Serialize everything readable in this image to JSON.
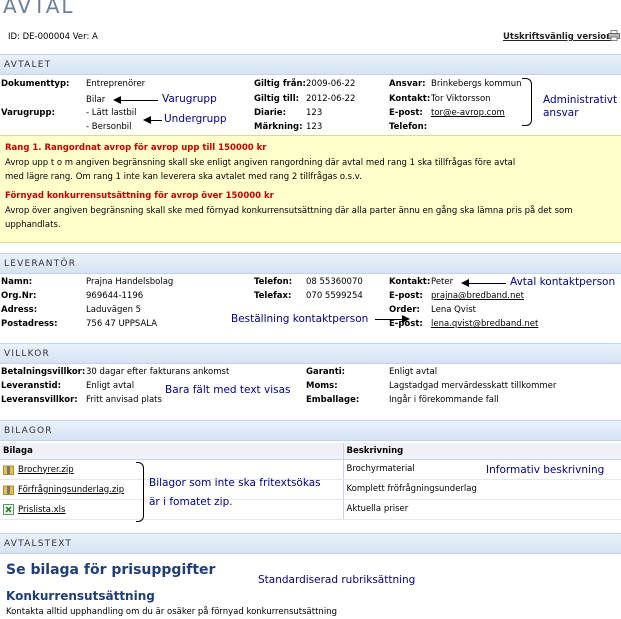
{
  "page": {
    "title": "AVTAL",
    "id_line": "ID: DE-000004 Ver: A",
    "print_link": "Utskriftsvänlig version"
  },
  "sections": {
    "avtalet": "AVTALET",
    "leverantor": "LEVERANTÖR",
    "villkor": "VILLKOR",
    "bilagor": "BILAGOR",
    "avtalstext": "AVTALSTEXT"
  },
  "avtalet": {
    "dokumenttyp_label": "Dokumenttyp:",
    "dokumenttyp": "Entreprenörer",
    "varugrupp_label": "Varugrupp:",
    "varugrupp": "Bilar",
    "undergrupp_1": "- Lätt lastbil",
    "undergrupp_2": "- Bersonbil",
    "giltig_fran_label": "Giltig från:",
    "giltig_fran": "2009-06-22",
    "giltig_till_label": "Giltig till:",
    "giltig_till": "2012-06-22",
    "diarie_label": "Diarie:",
    "diarie": "123",
    "markning_label": "Märkning:",
    "markning": "123",
    "ansvar_label": "Ansvar:",
    "ansvar": "Brinkebergs kommun",
    "kontakt_label": "Kontakt:",
    "kontakt": "Tor Viktorsson",
    "epost_label": "E-post:",
    "epost": "tor@e-avrop.com",
    "telefon_label": "Telefon:"
  },
  "rank": {
    "title1": "Rang 1. Rangordnat avrop för avrop upp till 150000 kr",
    "text1a": "Avrop upp t o m angiven begränsning skall ske enligt angiven rangordning där avtal med rang 1 ska tillfrågas före avtal",
    "text1b": "med lägre rang. Om rang 1 inte kan leverera ska avtalet med rang 2 tillfrågas o.s.v.",
    "title2": "Förnyad konkurrensutsättning för avrop över 150000 kr",
    "text2a": "Avrop över angiven begränsning skall ske med förnyad konkurrensutsättning där alla parter ännu en gång ska lämna pris på det som",
    "text2b": "upphandlats."
  },
  "leverantor": {
    "namn_label": "Namn:",
    "namn": "Prajna Handelsbolag",
    "orgnr_label": "Org.Nr:",
    "orgnr": "969644-1196",
    "adress_label": "Adress:",
    "adress": "Laduvägen 5",
    "postadress_label": "Postadress:",
    "postadress": "756 47 UPPSALA",
    "telefon_label": "Telefon:",
    "telefon": "08 55360070",
    "telefax_label": "Telefax:",
    "telefax": "070 5599254",
    "kontakt_label": "Kontakt:",
    "kontakt": "Peter",
    "epost_label": "E-post:",
    "epost": "prajna@bredband.net",
    "order_label": "Order:",
    "order": "Lena Qvist",
    "epost2_label": "E-post:",
    "epost2": "lena.qvist@bredband.net"
  },
  "villkor": {
    "betalning_label": "Betalningsvillkor:",
    "betalning": "30 dagar efter fakturans ankomst",
    "leveranstid_label": "Leveranstid:",
    "leveranstid": "Enligt avtal",
    "leveransvillkor_label": "Leveransvillkor:",
    "leveransvillkor": "Fritt anvisad plats",
    "garanti_label": "Garanti:",
    "garanti": "Enligt avtal",
    "moms_label": "Moms:",
    "moms": "Lagstadgad mervärdesskatt tillkommer",
    "emballage_label": "Emballage:",
    "emballage": "Ingår i förekommande fall"
  },
  "bilagor": {
    "col_bilaga": "Bilaga",
    "col_beskrivning": "Beskrivning",
    "rows": [
      {
        "file": "Brochyrer.zip",
        "desc": "Brochyrmaterial"
      },
      {
        "file": "Förfrågningsunderlag.zip",
        "desc": "Komplett fröfrågningsunderlag"
      },
      {
        "file": "Prislista.xls",
        "desc": "Aktuella priser"
      }
    ]
  },
  "avtalstext": {
    "heading1": "Se bilaga för prisuppgifter",
    "heading2": "Konkurrensutsättning",
    "body": "Kontakta alltid upphandling om du är osäker på förnyad konkurrensutsättning"
  },
  "annotations": {
    "varugrupp": "Varugrupp",
    "undergrupp": "Undergrupp",
    "admin1": "Administrativt",
    "admin2": "ansvar",
    "avtal_kontakt": "Avtal kontaktperson",
    "bestallning": "Beställning kontaktperson",
    "bara_falt": "Bara fält med text visas",
    "informativ": "Informativ beskrivning",
    "bilagor1": "Bilagor som inte ska fritextsökas",
    "bilagor2": "är i fomatet zip.",
    "standard": "Standardiserad rubriksättning"
  },
  "colors": {
    "section_bg": "#d6e3f4",
    "rank_bg": "#ffffcc",
    "rank_title": "#cc0000",
    "annotation": "#00008b",
    "heading": "#1f3d7a"
  }
}
